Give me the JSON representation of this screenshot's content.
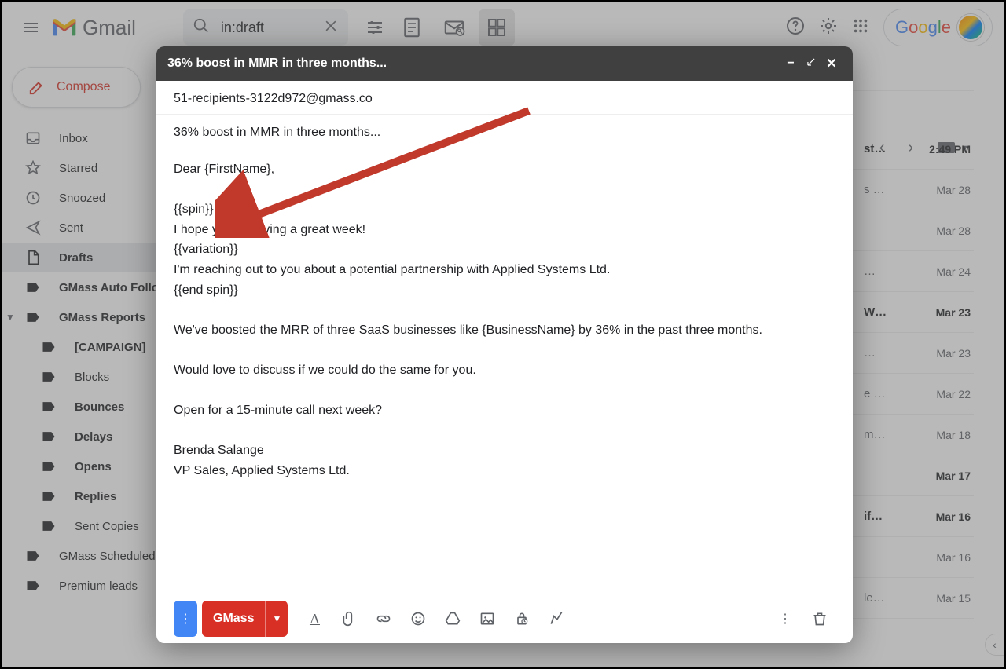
{
  "app": {
    "name": "Gmail",
    "google": "Google"
  },
  "search": {
    "query": "in:draft"
  },
  "compose_label": "Compose",
  "nav": {
    "inbox": "Inbox",
    "starred": "Starred",
    "snoozed": "Snoozed",
    "sent": "Sent",
    "drafts": "Drafts",
    "gmass_auto": "GMass Auto Followup",
    "gmass_reports": "GMass Reports",
    "campaign": "[CAMPAIGN]",
    "blocks": "Blocks",
    "bounces": "Bounces",
    "delays": "Delays",
    "opens": "Opens",
    "replies": "Replies",
    "sent_copies": "Sent Copies",
    "gmass_sched": "GMass Scheduled",
    "premium": "Premium leads"
  },
  "mail": [
    {
      "subj": "st…",
      "date": "2:49 PM",
      "bold": true
    },
    {
      "subj": "s …",
      "date": "Mar 28",
      "bold": false
    },
    {
      "subj": "",
      "date": "Mar 28",
      "bold": false
    },
    {
      "subj": "…",
      "date": "Mar 24",
      "bold": false
    },
    {
      "subj": "W…",
      "date": "Mar 23",
      "bold": true
    },
    {
      "subj": "…",
      "date": "Mar 23",
      "bold": false
    },
    {
      "subj": "e …",
      "date": "Mar 22",
      "bold": false
    },
    {
      "subj": "m…",
      "date": "Mar 18",
      "bold": false
    },
    {
      "subj": "",
      "date": "Mar 17",
      "bold": true
    },
    {
      "subj": " if…",
      "date": "Mar 16",
      "bold": true
    },
    {
      "subj": "",
      "date": "Mar 16",
      "bold": false
    },
    {
      "subj": "le…",
      "date": "Mar 15",
      "bold": false
    }
  ],
  "dialog": {
    "title": "36% boost in MMR in three months...",
    "to": "51-recipients-3122d972@gmass.co",
    "subject": "36% boost in MMR in three months...",
    "body": [
      "Dear {FirstName},",
      "",
      "{{spin}}",
      "I hope you're having a great week!",
      "{{variation}}",
      "I'm reaching out to you about a potential partnership with Applied Systems Ltd.",
      "{{end spin}}",
      "",
      "We've boosted the MRR of three SaaS businesses like {BusinessName} by 36% in the past three months.",
      "",
      "Would love to discuss if we could do the same for you.",
      "",
      "Open for a 15-minute call next week?",
      "",
      "Brenda Salange",
      "VP Sales, Applied Systems Ltd."
    ],
    "gmass_label": "GMass"
  }
}
